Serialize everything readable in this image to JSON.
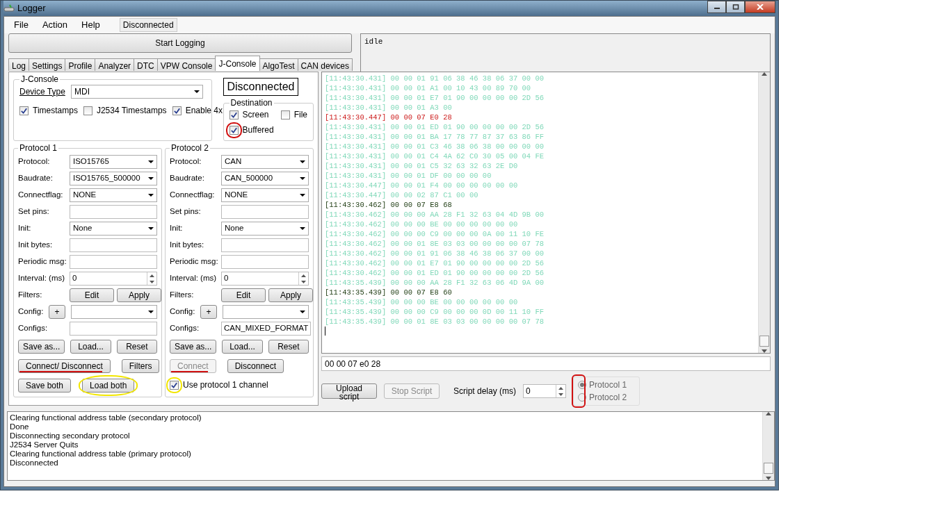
{
  "window": {
    "title": "Logger"
  },
  "menu": [
    {
      "label": "File"
    },
    {
      "label": "Action"
    },
    {
      "label": "Help"
    }
  ],
  "connection_status": "Disconnected",
  "start_button": "Start Logging",
  "status_box": "idle",
  "tabs": [
    {
      "label": "Log",
      "selected": false
    },
    {
      "label": "Settings",
      "selected": false
    },
    {
      "label": "Profile",
      "selected": false
    },
    {
      "label": "Analyzer",
      "selected": false
    },
    {
      "label": "DTC",
      "selected": false
    },
    {
      "label": "VPW Console",
      "selected": false
    },
    {
      "label": "J-Console",
      "selected": true
    },
    {
      "label": "AlgoTest",
      "selected": false
    },
    {
      "label": "CAN devices",
      "selected": false
    }
  ],
  "jconsole": {
    "title": "J-Console",
    "device_type_label": "Device Type",
    "device_type": "MDI",
    "options": [
      {
        "label": "Timestamps",
        "checked": true
      },
      {
        "label": "J2534 Timestamps",
        "checked": false
      },
      {
        "label": "Enable 4x",
        "checked": true
      }
    ]
  },
  "status_label": "Disconnected",
  "destination": {
    "title": "Destination",
    "options": [
      {
        "label": "Screen",
        "checked": true
      },
      {
        "label": "File",
        "checked": false
      },
      {
        "label": "Buffered",
        "checked": true,
        "highlight": {
          "kind": "circle",
          "color": "#d01010"
        }
      }
    ]
  },
  "protocols": [
    {
      "title": "Protocol 1",
      "rows": [
        {
          "kind": "select",
          "label": "Protocol:",
          "value": "ISO15765"
        },
        {
          "kind": "select",
          "label": "Baudrate:",
          "value": "ISO15765_500000"
        },
        {
          "kind": "select",
          "label": "Connectflag:",
          "value": "NONE"
        },
        {
          "kind": "text",
          "label": "Set pins:"
        },
        {
          "kind": "select",
          "label": "Init:",
          "value": "None"
        },
        {
          "kind": "text",
          "label": "Init bytes:"
        },
        {
          "kind": "text",
          "label": "Periodic msg:"
        },
        {
          "kind": "spin",
          "label": "Interval: (ms)",
          "value": "0"
        },
        {
          "kind": "buttons",
          "label": "Filters:",
          "buttons": [
            "Edit",
            "Apply"
          ]
        },
        {
          "kind": "config",
          "label": "Config:",
          "button": "+"
        },
        {
          "kind": "text",
          "label": "Configs:"
        }
      ],
      "file_buttons": [
        "Save as...",
        "Load...",
        "Reset"
      ],
      "bottom": [
        {
          "kind": "button",
          "label": "Connect/ Disconnect",
          "disabled": false,
          "highlight": {
            "kind": "underline",
            "color": "#d01010"
          }
        },
        {
          "kind": "button",
          "label": "Filters",
          "disabled": false
        },
        {
          "kind": "break"
        },
        {
          "kind": "button",
          "label": "Save both",
          "disabled": false
        },
        {
          "kind": "button",
          "label": "Load both",
          "disabled": false,
          "highlight": {
            "kind": "circle",
            "color": "#f2e600"
          }
        }
      ]
    },
    {
      "title": "Protocol 2",
      "rows": [
        {
          "kind": "select",
          "label": "Protocol:",
          "value": "CAN"
        },
        {
          "kind": "select",
          "label": "Baudrate:",
          "value": "CAN_500000"
        },
        {
          "kind": "select",
          "label": "Connectflag:",
          "value": "NONE"
        },
        {
          "kind": "text",
          "label": "Set pins:"
        },
        {
          "kind": "select",
          "label": "Init:",
          "value": "None"
        },
        {
          "kind": "text",
          "label": "Init bytes:"
        },
        {
          "kind": "text",
          "label": "Periodic msg:"
        },
        {
          "kind": "spin",
          "label": "Interval: (ms)",
          "value": "0"
        },
        {
          "kind": "buttons",
          "label": "Filters:",
          "buttons": [
            "Edit",
            "Apply"
          ]
        },
        {
          "kind": "config",
          "label": "Config:",
          "button": "+"
        },
        {
          "kind": "text",
          "label": "Configs:",
          "value": "CAN_MIXED_FORMAT"
        }
      ],
      "file_buttons": [
        "Save as...",
        "Load...",
        "Reset"
      ],
      "bottom": [
        {
          "kind": "button",
          "label": "Connect",
          "disabled": true,
          "highlight": {
            "kind": "underline",
            "color": "#d01010"
          }
        },
        {
          "kind": "button",
          "label": "Disconnect",
          "disabled": false
        },
        {
          "kind": "break"
        },
        {
          "kind": "checkbox",
          "label": "Use protocol 1 channel",
          "checked": true,
          "highlight": {
            "kind": "circle",
            "color": "#f2e600"
          }
        }
      ]
    }
  ],
  "console_lines": [
    {
      "kind": "rx",
      "text": "[11:43:30.431] 00 00 01 91 06 38 46 38 06 37 00 00"
    },
    {
      "kind": "rx",
      "text": "[11:43:30.431] 00 00 01 A1 00 10 43 00 89 70 00"
    },
    {
      "kind": "rx",
      "text": "[11:43:30.431] 00 00 01 E7 01 90 00 00 00 00 2D 56"
    },
    {
      "kind": "rx",
      "text": "[11:43:30.431] 00 00 01 A3 00"
    },
    {
      "kind": "sent",
      "text": "[11:43:30.447] 00 00 07 E0 28"
    },
    {
      "kind": "rx",
      "text": "[11:43:30.431] 00 00 01 ED 01 90 00 00 00 00 2D 56"
    },
    {
      "kind": "rx",
      "text": "[11:43:30.431] 00 00 01 BA 17 78 77 87 37 63 86 FF"
    },
    {
      "kind": "rx",
      "text": "[11:43:30.431] 00 00 01 C3 46 38 06 38 00 00 00 00"
    },
    {
      "kind": "rx",
      "text": "[11:43:30.431] 00 00 01 C4 4A 62 C0 30 05 00 04 FE"
    },
    {
      "kind": "rx",
      "text": "[11:43:30.431] 00 00 01 C5 32 63 32 63 2E D0"
    },
    {
      "kind": "rx",
      "text": "[11:43:30.431] 00 00 01 DF 00 00 00 00"
    },
    {
      "kind": "rx",
      "text": "[11:43:30.447] 00 00 01 F4 00 00 00 00 00 00"
    },
    {
      "kind": "rx",
      "text": "[11:43:30.447] 00 00 02 87 C1 00 00"
    },
    {
      "kind": "reply",
      "text": "[11:43:30.462] 00 00 07 E8 68"
    },
    {
      "kind": "rx",
      "text": "[11:43:30.462] 00 00 00 AA 28 F1 32 63 04 4D 9B 00"
    },
    {
      "kind": "rx",
      "text": "[11:43:30.462] 00 00 00 BE 00 00 00 00 00 00"
    },
    {
      "kind": "rx",
      "text": "[11:43:30.462] 00 00 00 C9 00 00 00 0A 00 11 10 FE"
    },
    {
      "kind": "rx",
      "text": "[11:43:30.462] 00 00 01 8E 03 03 00 00 00 00 07 78"
    },
    {
      "kind": "rx",
      "text": "[11:43:30.462] 00 00 01 91 06 38 46 38 06 37 00 00"
    },
    {
      "kind": "rx",
      "text": "[11:43:30.462] 00 00 01 E7 01 90 00 00 00 00 2D 56"
    },
    {
      "kind": "rx",
      "text": "[11:43:30.462] 00 00 01 ED 01 90 00 00 00 00 2D 56"
    },
    {
      "kind": "rx",
      "text": "[11:43:35.439] 00 00 00 AA 28 F1 32 63 06 4D 9A 00"
    },
    {
      "kind": "reply",
      "text": "[11:43:35.439] 00 00 07 E8 60"
    },
    {
      "kind": "rx",
      "text": "[11:43:35.439] 00 00 00 BE 00 00 00 00 00 00"
    },
    {
      "kind": "rx",
      "text": "[11:43:35.439] 00 00 00 C9 00 00 00 0D 00 11 10 FF"
    },
    {
      "kind": "rx",
      "text": "[11:43:35.439] 00 00 01 8E 03 03 00 00 00 00 07 78"
    }
  ],
  "command_input": "00 00 07 e0 28",
  "script_buttons": [
    {
      "label": "Upload script",
      "disabled": false
    },
    {
      "label": "Stop Script",
      "disabled": true
    }
  ],
  "script_delay_label": "Script delay (ms)",
  "script_delay": "0",
  "protocol_choice": {
    "highlight": {
      "kind": "circle",
      "color": "#d01010"
    },
    "options": [
      {
        "label": "Protocol 1",
        "selected": true
      },
      {
        "label": "Protocol 2",
        "selected": false
      }
    ]
  },
  "output_lines": [
    "Clearing functional address table (secondary protocol)",
    "Done",
    "Disconnecting secondary protocol",
    "J2534 Server Quits",
    "Clearing functional address table (primary protocol)",
    "Disconnected"
  ]
}
